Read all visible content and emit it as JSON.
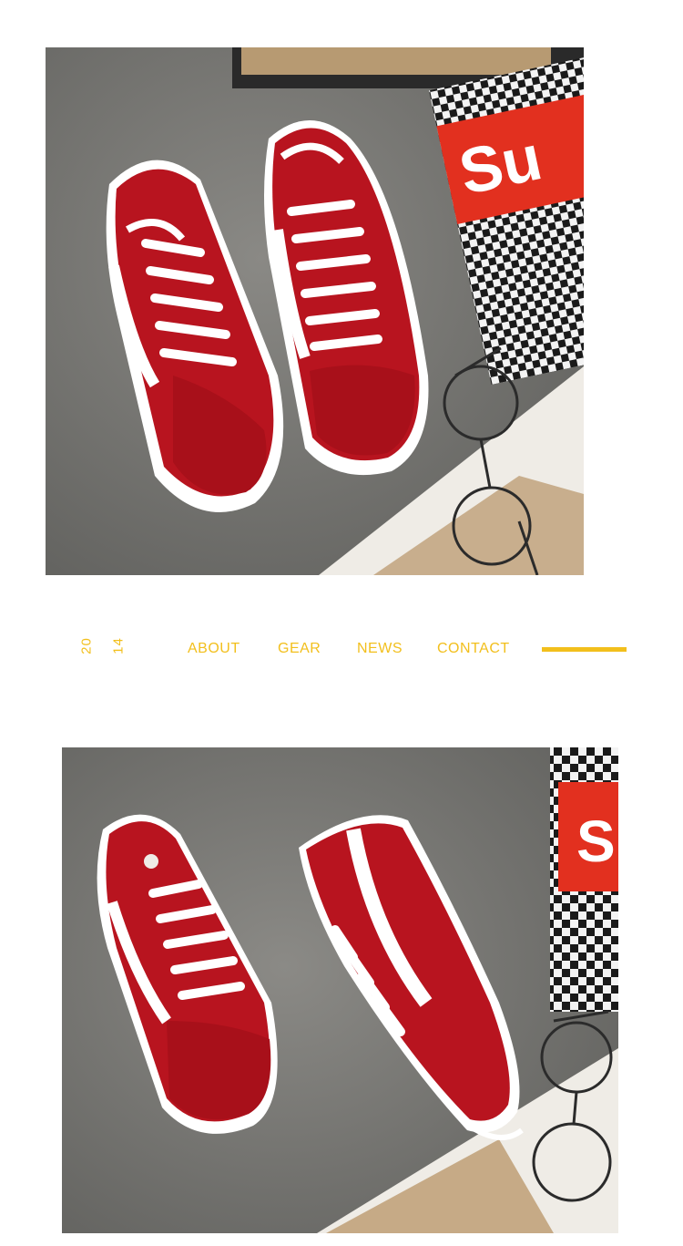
{
  "nav": {
    "year_top": "20",
    "year_bottom": "14",
    "links": [
      "ABOUT",
      "GEAR",
      "NEWS",
      "CONTACT"
    ],
    "accent_color": "#f2bf1c"
  },
  "photos": [
    {
      "subject": "red canvas low-top sneakers pair, top view",
      "props": [
        "checkered box",
        "round glasses",
        "magazine page"
      ],
      "box_text": "Su"
    },
    {
      "subject": "red canvas low-top sneakers, one on its side",
      "props": [
        "checkered box",
        "round glasses",
        "magazine page"
      ],
      "box_text": "S"
    }
  ]
}
